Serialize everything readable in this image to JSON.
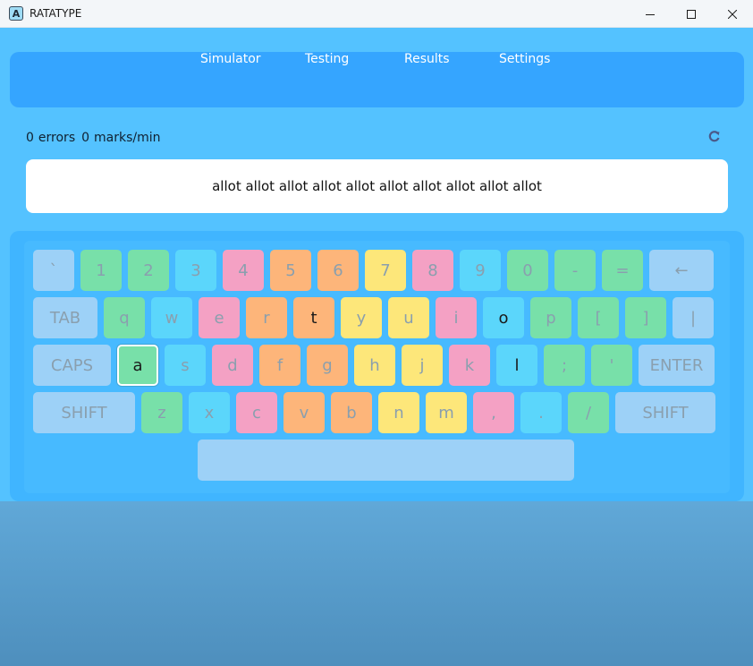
{
  "window": {
    "title": "RATATYPE",
    "app_icon_letter": "A",
    "controls": [
      "minimize-icon",
      "maximize-icon",
      "close-icon"
    ]
  },
  "nav": {
    "items": [
      {
        "label": "Simulator"
      },
      {
        "label": "Testing"
      },
      {
        "label": "Results"
      },
      {
        "label": "Settings"
      }
    ]
  },
  "stats": {
    "errors_value": "0",
    "errors_label": "errors",
    "speed_value": "0",
    "speed_label": "marks/min",
    "refresh_icon": "refresh-icon"
  },
  "exercise": {
    "text": "allot allot allot allot allot allot allot allot allot allot"
  },
  "keyboard": {
    "colors": {
      "blue": "#9dd1f7",
      "green": "#78e0a9",
      "cyan": "#5bd6fb",
      "pink": "#f4a1c4",
      "orange": "#fdb57a",
      "yellow": "#fde77a"
    },
    "active_key": "a",
    "rows": [
      [
        {
          "label": "`",
          "color": "blue"
        },
        {
          "label": "1",
          "color": "green"
        },
        {
          "label": "2",
          "color": "green"
        },
        {
          "label": "3",
          "color": "cyan"
        },
        {
          "label": "4",
          "color": "pink"
        },
        {
          "label": "5",
          "color": "orange"
        },
        {
          "label": "6",
          "color": "orange"
        },
        {
          "label": "7",
          "color": "yellow"
        },
        {
          "label": "8",
          "color": "pink"
        },
        {
          "label": "9",
          "color": "cyan"
        },
        {
          "label": "0",
          "color": "green"
        },
        {
          "label": "-",
          "color": "green"
        },
        {
          "label": "=",
          "color": "green"
        },
        {
          "label": "←",
          "color": "blue"
        }
      ],
      [
        {
          "label": "TAB",
          "color": "blue"
        },
        {
          "label": "q",
          "color": "green"
        },
        {
          "label": "w",
          "color": "cyan"
        },
        {
          "label": "e",
          "color": "pink"
        },
        {
          "label": "r",
          "color": "orange"
        },
        {
          "label": "t",
          "color": "orange",
          "dark": true
        },
        {
          "label": "y",
          "color": "yellow"
        },
        {
          "label": "u",
          "color": "yellow"
        },
        {
          "label": "i",
          "color": "pink"
        },
        {
          "label": "o",
          "color": "cyan",
          "dark": true
        },
        {
          "label": "p",
          "color": "green"
        },
        {
          "label": "[",
          "color": "green"
        },
        {
          "label": "]",
          "color": "green"
        },
        {
          "label": "|",
          "color": "blue"
        }
      ],
      [
        {
          "label": "CAPS",
          "color": "blue"
        },
        {
          "label": "a",
          "color": "green",
          "dark": true
        },
        {
          "label": "s",
          "color": "cyan"
        },
        {
          "label": "d",
          "color": "pink"
        },
        {
          "label": "f",
          "color": "orange"
        },
        {
          "label": "g",
          "color": "orange"
        },
        {
          "label": "h",
          "color": "yellow"
        },
        {
          "label": "j",
          "color": "yellow"
        },
        {
          "label": "k",
          "color": "pink"
        },
        {
          "label": "l",
          "color": "cyan",
          "dark": true
        },
        {
          "label": ";",
          "color": "green"
        },
        {
          "label": "'",
          "color": "green"
        },
        {
          "label": "ENTER",
          "color": "blue"
        }
      ],
      [
        {
          "label": "SHIFT",
          "color": "blue"
        },
        {
          "label": "z",
          "color": "green"
        },
        {
          "label": "x",
          "color": "cyan"
        },
        {
          "label": "c",
          "color": "pink"
        },
        {
          "label": "v",
          "color": "orange"
        },
        {
          "label": "b",
          "color": "orange"
        },
        {
          "label": "n",
          "color": "yellow"
        },
        {
          "label": "m",
          "color": "yellow"
        },
        {
          "label": ",",
          "color": "pink"
        },
        {
          "label": ".",
          "color": "cyan"
        },
        {
          "label": "/",
          "color": "green"
        },
        {
          "label": "SHIFT",
          "color": "blue"
        }
      ],
      [
        {
          "label": "",
          "color": "blue"
        }
      ]
    ]
  }
}
